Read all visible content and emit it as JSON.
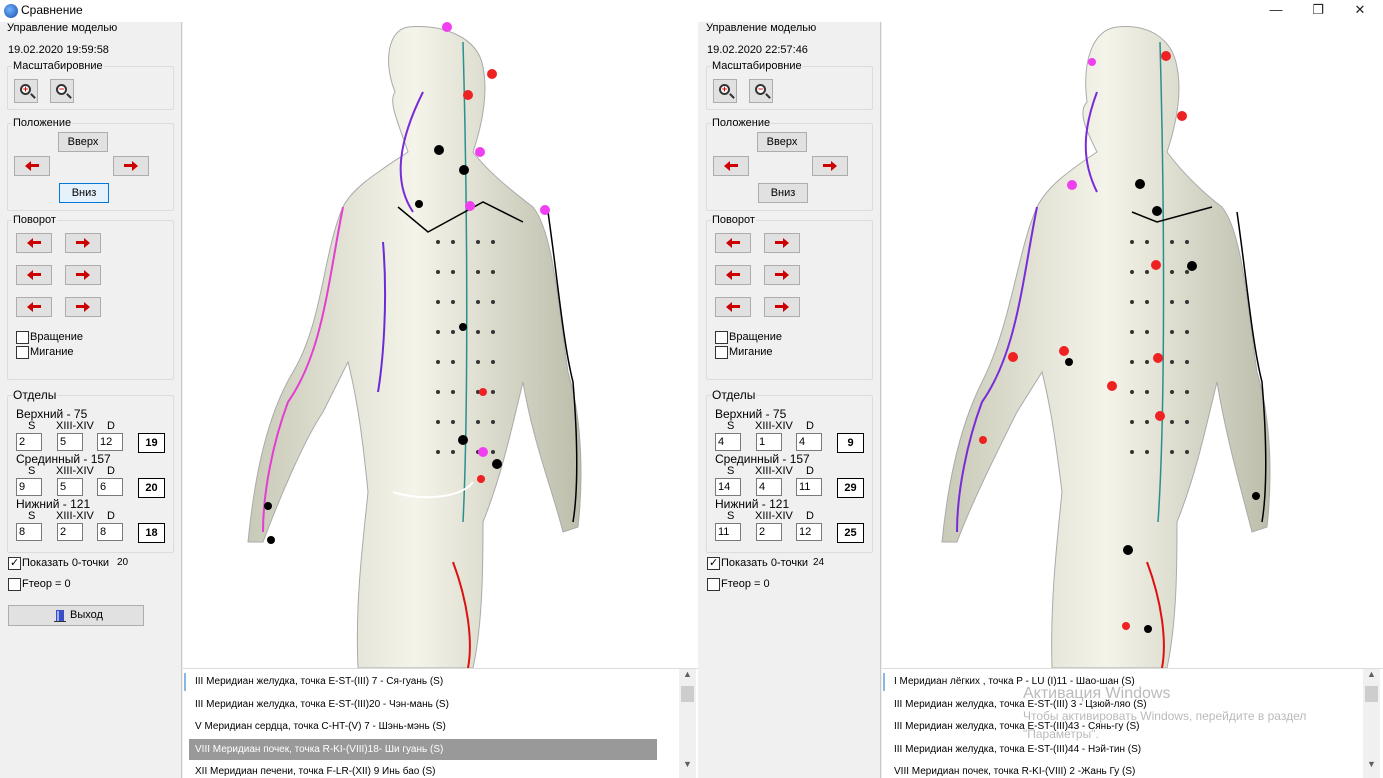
{
  "window": {
    "title": "Сравнение",
    "minimize": "—",
    "maximize": "❐",
    "close": "✕"
  },
  "panels": [
    {
      "section_title": "Управление моделью",
      "timestamp": "19.02.2020 19:59:58",
      "zoom_title": "Масштабировние",
      "position_title": "Положение",
      "up_label": "Вверх",
      "down_label": "Вниз",
      "rotation_title": "Поворот",
      "rotate_label": "Вращение",
      "blink_label": "Мигание",
      "divisions_title": "Отделы",
      "upper_label": "Верхний - 75",
      "middle_label": "Срединный - 157",
      "lower_label": "Нижний - 121",
      "col_s": "S",
      "col_xiii": "XIII-XIV",
      "col_d": "D",
      "upper": {
        "s": "2",
        "xiii": "5",
        "d": "12",
        "total": "19"
      },
      "middle": {
        "s": "9",
        "xiii": "5",
        "d": "6",
        "total": "20"
      },
      "lower": {
        "s": "8",
        "xiii": "2",
        "d": "8",
        "total": "18"
      },
      "show_zero_label": "Показать 0-точки",
      "show_zero_checked": true,
      "zero_count": "20",
      "ftheor_label": "Fтеор = 0",
      "ftheor_checked": false,
      "exit_label": "Выход"
    },
    {
      "section_title": "Управление моделью",
      "timestamp": "19.02.2020 22:57:46",
      "zoom_title": "Масштабировние",
      "position_title": "Положение",
      "up_label": "Вверх",
      "down_label": "Вниз",
      "rotation_title": "Поворот",
      "rotate_label": "Вращение",
      "blink_label": "Мигание",
      "divisions_title": "Отделы",
      "upper_label": "Верхний - 75",
      "middle_label": "Срединный - 157",
      "lower_label": "Нижний - 121",
      "col_s": "S",
      "col_xiii": "XIII-XIV",
      "col_d": "D",
      "upper": {
        "s": "4",
        "xiii": "1",
        "d": "4",
        "total": "9"
      },
      "middle": {
        "s": "14",
        "xiii": "4",
        "d": "11",
        "total": "29"
      },
      "lower": {
        "s": "11",
        "xiii": "2",
        "d": "12",
        "total": "25"
      },
      "show_zero_label": "Показать 0-точки",
      "show_zero_checked": true,
      "zero_count": "24",
      "ftheor_label": "Fтеор = 0",
      "ftheor_checked": false
    }
  ],
  "left_list": [
    "III Меридиан желудка, точка  E-ST-(III) 7 - Ся-гуань (S)",
    "III Меридиан желудка, точка  E-ST-(III)20 - Чэн-мань (S)",
    "V Меридиан сердца, точка  C-HT-(V) 7 - Шэнь-мэнь (S)",
    "VIII Меридиан почек, точка  R-KI-(VIII)18- Ши гуань (S)",
    "XII Меридиан печени, точка F-LR-(XII)  9 Инь бао (S)"
  ],
  "left_list_selected": 3,
  "right_list": [
    "I Меридиан лёгких , точка  P - LU (I)11 - Шао-шан (S)",
    "III Меридиан желудка, точка  E-ST-(III) 3 - Цзюй-ляо (S)",
    "III Меридиан желудка, точка  E-ST-(III)43 - Сянь-гу (S)",
    "III Меридиан желудка, точка  E-ST-(III)44 - Нэй-тин (S)",
    "VIII Меридиан почек, точка  R-KI-(VIII) 2 -Жань Гу (S)"
  ],
  "watermark": {
    "line1": "Активация Windows",
    "line2": "Чтобы активировать Windows, перейдите в раздел",
    "line3": "\"Параметры\"."
  },
  "icons": {
    "app": "app-icon",
    "zoom_in": "zoom-in-icon",
    "zoom_out": "zoom-out-icon",
    "left": "arrow-left-icon",
    "right": "arrow-right-icon",
    "exit": "exit-door-icon"
  },
  "colors": {
    "accent": "#0078d7",
    "selection": "#999999",
    "arrow": "#cc0000"
  }
}
